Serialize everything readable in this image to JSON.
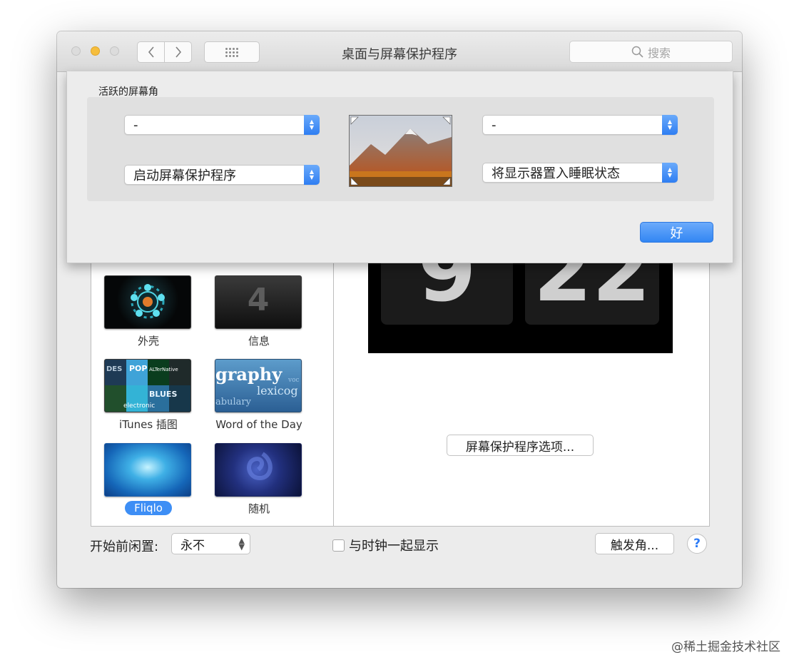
{
  "window": {
    "title": "桌面与屏幕保护程序",
    "search_placeholder": "搜索"
  },
  "hot_corners": {
    "title": "活跃的屏幕角",
    "top_left": "-",
    "top_right": "-",
    "bottom_left": "启动屏幕保护程序",
    "bottom_right": "将显示器置入睡眠状态",
    "ok_label": "好"
  },
  "screen_savers": [
    {
      "label": "外壳",
      "selected": false
    },
    {
      "label": "信息",
      "selected": false
    },
    {
      "label": "iTunes 插图",
      "selected": false
    },
    {
      "label": "Word of the Day",
      "selected": false
    },
    {
      "label": "Fliqlo",
      "selected": true
    },
    {
      "label": "随机",
      "selected": false
    }
  ],
  "thumbnail_text": {
    "word_graphy": "graphy",
    "word_lexico": "lexicog",
    "word_ulary": "abulary",
    "word_voc": "voc",
    "itunes_pop": "POP",
    "itunes_alt": "ALTerNative",
    "itunes_blues": "BLUES",
    "itunes_electronic": "electronic",
    "itunes_des": "DES",
    "info_glyph": "4"
  },
  "preview": {
    "hour": "9",
    "minute": "22",
    "options_label": "屏幕保护程序选项..."
  },
  "bottom": {
    "idle_label": "开始前闲置:",
    "idle_value": "永不",
    "show_clock_label": "与时钟一起显示",
    "hot_corners_label": "触发角...",
    "help_label": "?"
  },
  "credit": "@稀土掘金技术社区",
  "colors": {
    "accent": "#3d8ef5",
    "ok_button": "#3a88f4",
    "stepper": "#2f7ef2"
  }
}
